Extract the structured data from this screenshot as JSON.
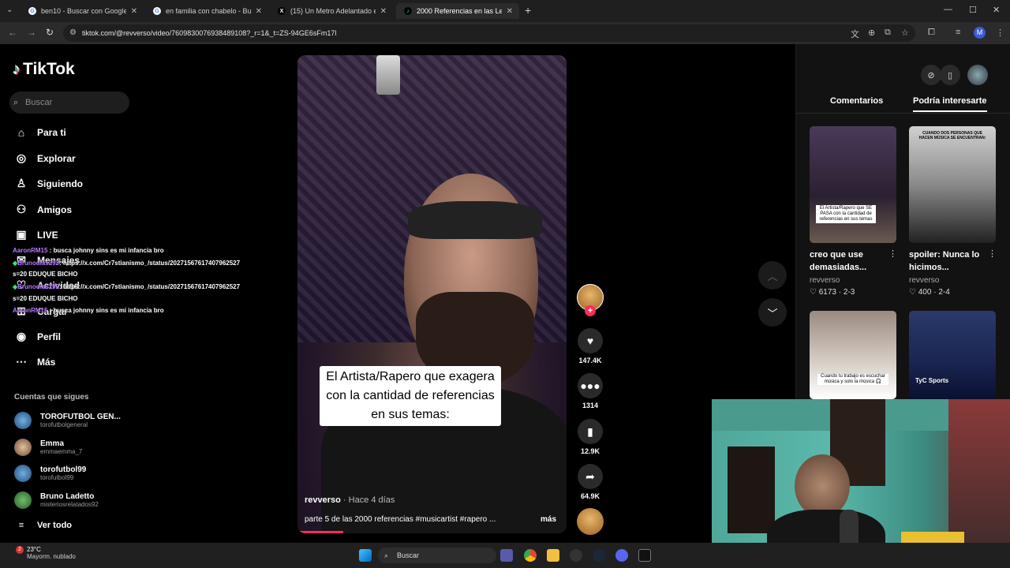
{
  "browser": {
    "tabs": [
      {
        "title": "ben10 - Buscar con Google",
        "favicon": "G"
      },
      {
        "title": "en familia con chabelo - Buscar",
        "favicon": "G"
      },
      {
        "title": "(15) Un Metro Adelantado en X",
        "favicon": "X"
      },
      {
        "title": "2000 Referencias en las Letras",
        "favicon": "♪"
      }
    ],
    "url": "tiktok.com/@revverso/video/7609830076938489108?_r=1&_t=ZS-94GE6sFm17l",
    "new_tab": "+"
  },
  "sidebar": {
    "logo": "TikTok",
    "search_placeholder": "Buscar",
    "nav": [
      {
        "label": "Para ti",
        "icon": "home-icon"
      },
      {
        "label": "Explorar",
        "icon": "compass-icon"
      },
      {
        "label": "Siguiendo",
        "icon": "following-icon"
      },
      {
        "label": "Amigos",
        "icon": "friends-icon"
      },
      {
        "label": "LIVE",
        "icon": "live-icon"
      },
      {
        "label": "Mensajes",
        "icon": "message-icon"
      },
      {
        "label": "Actividad",
        "icon": "activity-icon"
      },
      {
        "label": "Cargar",
        "icon": "upload-icon"
      },
      {
        "label": "Perfil",
        "icon": "profile-icon"
      },
      {
        "label": "Más",
        "icon": "more-icon"
      }
    ],
    "following_title": "Cuentas que sigues",
    "accounts": [
      {
        "name": "TOROFUTBOL GEN...",
        "handle": "torofutbolgeneral"
      },
      {
        "name": "Emma",
        "handle": "emmaemma_7"
      },
      {
        "name": "torofutbol99",
        "handle": "torofutbol99"
      },
      {
        "name": "Bruno Ladetto",
        "handle": "misteriosrelatados92"
      }
    ],
    "see_all": "Ver todo"
  },
  "chat": [
    {
      "user": "AaronRM15",
      "text": " : busca johnny sins es mi infancia bro"
    },
    {
      "user": "Brunodias292",
      "text": ": https://x.com/Cr7stianismo_/status/20271567617407962527"
    },
    {
      "user": "",
      "text": "s=20 EDUQUE BICHO"
    },
    {
      "user": "Brunodias292",
      "text": ": https://x.com/Cr7stianismo_/status/20271567617407962527"
    },
    {
      "user": "",
      "text": "s=20 EDUQUE BICHO"
    },
    {
      "user": "AaronRM15",
      "text": " : busca johnny sins es mi infancia bro"
    }
  ],
  "video": {
    "caption": "El Artista/Rapero que exagera con la cantidad de referencias en sus temas:",
    "author": "revverso",
    "ago": " · Hace 4 días",
    "description": "parte 5 de las 2000 referencias #musicartist #rapero ...",
    "more": "más",
    "progress_fraction": 0.17
  },
  "actions": {
    "likes": "147.4K",
    "comments": "1314",
    "saves": "12.9K",
    "shares": "64.9K"
  },
  "right_panel": {
    "tabs": [
      "Comentarios",
      "Podría interesarte"
    ],
    "active_tab": "Podría interesarte",
    "videos": [
      {
        "title": "creo que use demasiadas...",
        "author": "revverso",
        "likes": "6173",
        "part": "2-3",
        "overlay": "El Artista/Rapero que SE PASA con la cantidad de referencias en sus temas"
      },
      {
        "title": "spoiler: Nunca lo hicimos...",
        "author": "revverso",
        "likes": "400",
        "part": "2-4",
        "overlay": "CUANDO DOS PERSONAS QUE HACEN MÚSICA SE ENCUENTRAN:"
      },
      {
        "title": "",
        "author": "",
        "likes": "",
        "part": "",
        "overlay": "Cuando tu trabajo es escuchar música y solo la música 🎧"
      },
      {
        "title": "",
        "author": "",
        "likes": "",
        "part": "",
        "overlay": "TyC Sports"
      }
    ]
  },
  "taskbar": {
    "temp": "23°C",
    "weather": "Mayorm. nublado",
    "search": "Buscar",
    "notif": "2"
  }
}
